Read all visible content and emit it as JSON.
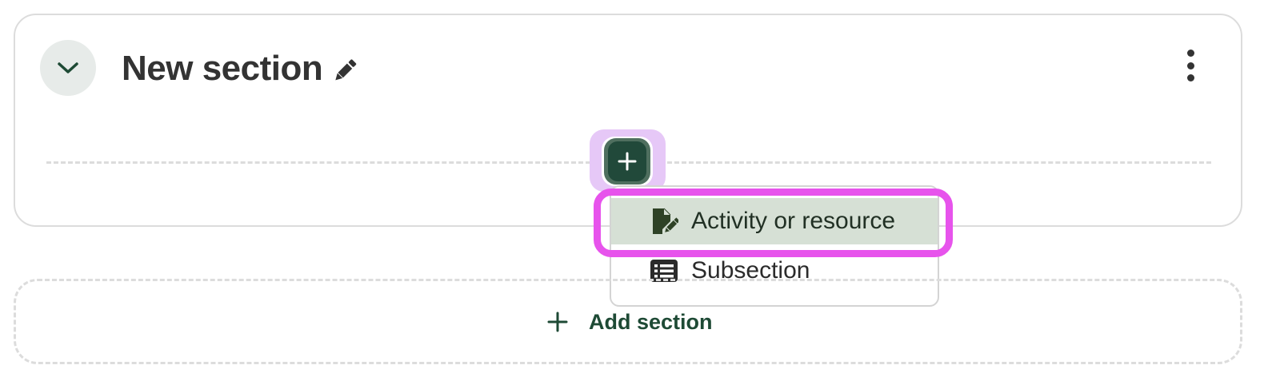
{
  "section": {
    "title": "New section"
  },
  "add_menu": {
    "items": [
      {
        "label": "Activity or resource",
        "icon": "file-edit-icon"
      },
      {
        "label": "Subsection",
        "icon": "list-icon"
      }
    ]
  },
  "add_section": {
    "label": "Add section"
  },
  "colors": {
    "accent": "#21493a",
    "highlight": "#e753ec",
    "selected_item_bg": "#d6e0d5",
    "focus_ring": "#e6c8f7"
  }
}
